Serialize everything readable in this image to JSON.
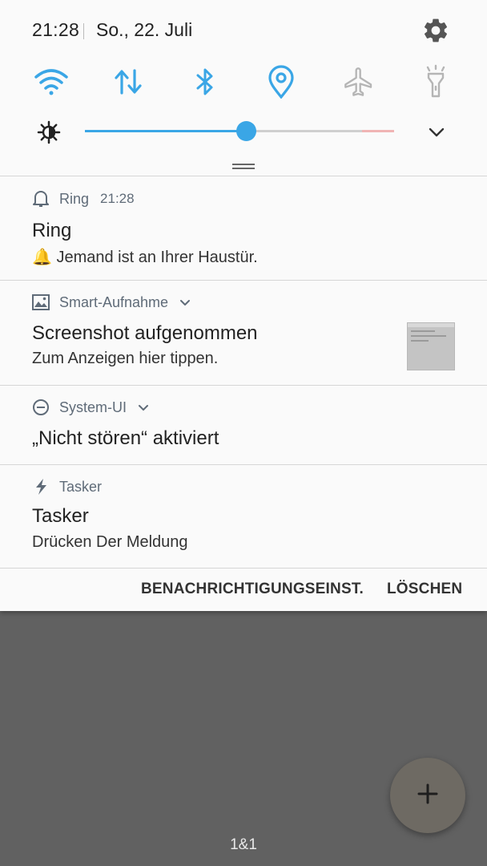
{
  "status_bar": {
    "time": "21:28",
    "date": "So., 22. Juli"
  },
  "quick_settings": {
    "tiles": [
      {
        "icon": "wifi-icon",
        "active": true
      },
      {
        "icon": "mobile-data-icon",
        "active": true
      },
      {
        "icon": "bluetooth-icon",
        "active": true
      },
      {
        "icon": "location-icon",
        "active": true
      },
      {
        "icon": "airplane-mode-icon",
        "active": false
      },
      {
        "icon": "flashlight-icon",
        "active": false
      }
    ],
    "brightness_level": 0.52
  },
  "notifications": [
    {
      "app": "Ring",
      "time": "21:28",
      "title": "Ring",
      "text": "🔔 Jemand ist an Ihrer Haustür.",
      "icon": "bell-icon"
    },
    {
      "app": "Smart-Aufnahme",
      "title": "Screenshot aufgenommen",
      "text": "Zum Anzeigen hier tippen.",
      "icon": "image-icon"
    },
    {
      "app": "System-UI",
      "title": "„Nicht stören“ aktiviert",
      "icon": "do-not-disturb-icon"
    },
    {
      "app": "Tasker",
      "title": "Tasker",
      "text": "Drücken Der Meldung",
      "icon": "bolt-icon"
    }
  ],
  "actions": {
    "settings": "BENACHRICHTIGUNGSEINST.",
    "clear": "LÖSCHEN"
  },
  "carrier": "1&1",
  "colors": {
    "accent": "#3aa6e6",
    "inactive": "#b5b5b5",
    "panel": "#fafafa",
    "background": "#616161"
  }
}
